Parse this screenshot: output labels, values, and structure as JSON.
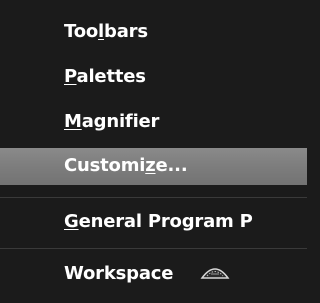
{
  "menu": {
    "items": [
      {
        "pre": "Too",
        "ul": "l",
        "post": "bars"
      },
      {
        "pre": "",
        "ul": "P",
        "post": "alettes"
      },
      {
        "pre": "",
        "ul": "M",
        "post": "agnifier"
      },
      {
        "pre": "Customi",
        "ul": "z",
        "post": "e..."
      },
      {
        "pre": "",
        "ul": "G",
        "post": "eneral Program P"
      },
      {
        "pre": "Workspace",
        "ul": "",
        "post": ""
      }
    ],
    "highlighted_item": "Customize...",
    "colors": {
      "background": "#1b1b1b",
      "text": "#ffffff",
      "highlight": "#7d7d7d",
      "separator": "#3a3a3a"
    },
    "icons": {
      "cursor": "hourglass-cursor-icon"
    }
  }
}
